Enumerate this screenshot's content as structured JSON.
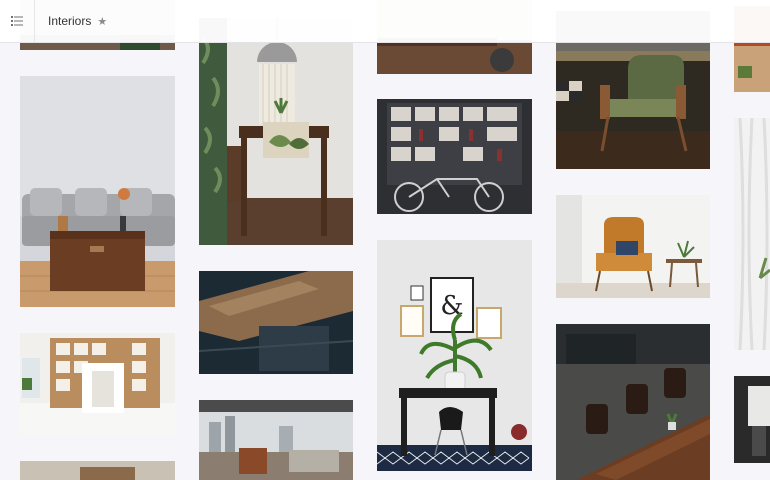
{
  "header": {
    "title": "Interiors",
    "menu_icon": "list-menu-icon",
    "favorite_icon": "star-icon",
    "favorite_glyph": "★"
  },
  "colors": {
    "background": "#f6f6fa",
    "topbar": "#ffffff",
    "text": "#333333",
    "icon": "#8a8a8a"
  }
}
